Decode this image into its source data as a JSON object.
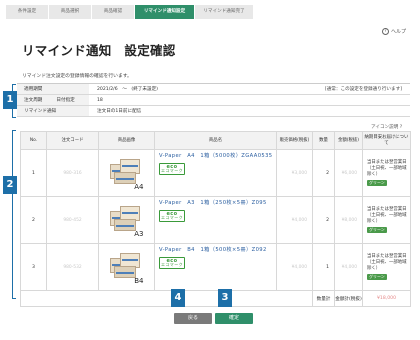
{
  "steps": [
    "条件設定",
    "商品選択",
    "商品確認",
    "リマインド通知設定",
    "リマインド通知完了"
  ],
  "help": {
    "icon": "?",
    "label": "ヘルプ"
  },
  "page_title": "リマインド通知　設定確認",
  "intro": "リマインド注文設定の登録情報の確認を行います。",
  "settings": {
    "period_label": "適用期間",
    "period_value": "2021/2/6　～　(終了未設定)",
    "period_note": "[通常：この設定を登録通り行います]",
    "order_cycle_label": "注文周期",
    "order_cycle_sub": "日付指定",
    "order_cycle_value": "18",
    "remind_label": "リマインド通知",
    "remind_value": "注文日の1日前に配信"
  },
  "badges": [
    "1",
    "2",
    "3",
    "4"
  ],
  "icon_desc": "アイコン説明 ?",
  "columns": {
    "no": "No.",
    "code": "注文コード",
    "image": "商品画像",
    "name": "商品名",
    "price": "販売価格(税抜)",
    "qty": "数量",
    "amount": "金額(税抜)",
    "return": "納期目安お届けについて"
  },
  "products": [
    {
      "no": "1",
      "code": "980-316",
      "size": "A4",
      "name": "V-Paper　A4　1箱（5000枚）ZGAA0535",
      "price": "¥3,000",
      "qty": "2",
      "amount": "¥6,000",
      "eco": "エコマーク",
      "return": "当日または翌営業日（土日祝、一部地域除く）",
      "green": "グリーン"
    },
    {
      "no": "2",
      "code": "980-452",
      "size": "A3",
      "name": "V-Paper　A3　1箱（250枚×5冊）Z095",
      "price": "¥4,000",
      "qty": "2",
      "amount": "¥8,000",
      "eco": "エコマーク",
      "return": "当日または翌営業日（土日祝、一部地域除く）",
      "green": "グリーン"
    },
    {
      "no": "3",
      "code": "980-532",
      "size": "B4",
      "name": "V-Paper　B4　1箱（500枚×5冊）Z092",
      "price": "¥4,000",
      "qty": "1",
      "amount": "¥4,000",
      "eco": "エコマーク",
      "return": "当日または翌営業日（土日祝、一部地域除く）",
      "green": "グリーン"
    }
  ],
  "totals": {
    "qty_label": "数量計",
    "qty": "5",
    "amount_label": "金額計(税抜)",
    "amount": "¥18,000"
  },
  "buttons": {
    "back": "戻る",
    "confirm": "確定"
  },
  "colors": {
    "accent": "#2f8f6a",
    "badge": "#1d6fa8",
    "link": "#2a5ea0"
  }
}
